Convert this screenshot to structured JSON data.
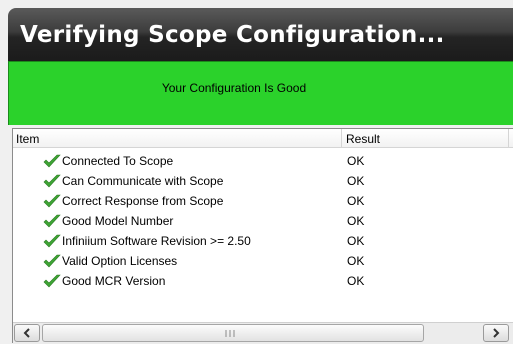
{
  "window": {
    "title": "Verifying Scope Configuration..."
  },
  "banner": {
    "text": "Your Configuration Is Good",
    "color": "#2bd22b"
  },
  "table": {
    "columns": [
      "Item",
      "Result"
    ],
    "rows": [
      {
        "item": "Connected To Scope",
        "result": "OK",
        "status_icon": "checkmark-icon"
      },
      {
        "item": "Can Communicate with Scope",
        "result": "OK",
        "status_icon": "checkmark-icon"
      },
      {
        "item": "Correct Response from Scope",
        "result": "OK",
        "status_icon": "checkmark-icon"
      },
      {
        "item": "Good Model Number",
        "result": "OK",
        "status_icon": "checkmark-icon"
      },
      {
        "item": "Infiniium Software Revision >= 2.50",
        "result": "OK",
        "status_icon": "checkmark-icon"
      },
      {
        "item": "Valid Option Licenses",
        "result": "OK",
        "status_icon": "checkmark-icon"
      },
      {
        "item": "Good MCR Version",
        "result": "OK",
        "status_icon": "checkmark-icon"
      }
    ]
  },
  "scrollbar": {
    "left_icon": "arrow-left-icon",
    "right_icon": "arrow-right-icon",
    "grip_icon": "grip-icon"
  }
}
